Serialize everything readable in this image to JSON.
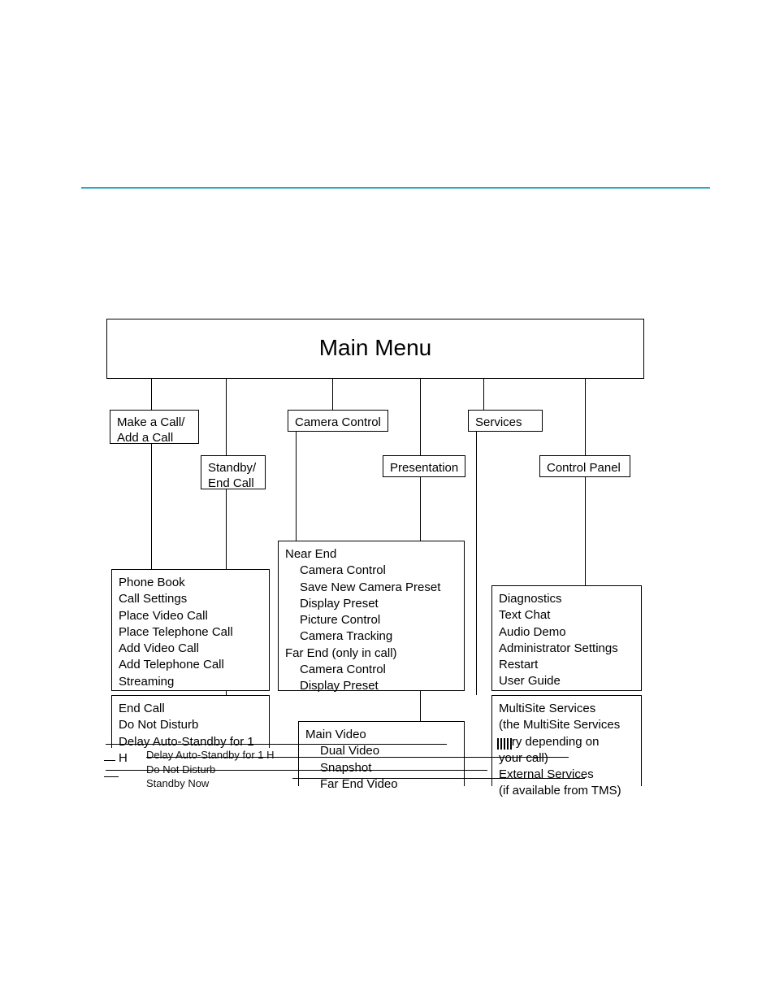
{
  "top": {
    "title": "Main Menu"
  },
  "row1": {
    "makeCall": "Make a Call/\nAdd a Call",
    "standby": "Standby/\nEnd Call",
    "camera": "Camera Control",
    "presentation": "Presentation",
    "services": "Services",
    "controlPanel": "Control Panel"
  },
  "callBox": {
    "items": [
      "Phone Book",
      "Call Settings",
      "Place Video Call",
      "Place Telephone Call",
      "Add Video Call",
      "Add Telephone Call",
      "Streaming"
    ]
  },
  "cameraBox": {
    "nearHeader": "Near End",
    "nearItems": [
      "Camera Control",
      "Save New Camera Preset",
      "Display Preset",
      "Picture Control",
      "Camera Tracking"
    ],
    "farHeader": "Far End (only in call)",
    "farItems": [
      "Camera Control",
      "Display Preset"
    ]
  },
  "controlBox": {
    "items": [
      "Diagnostics",
      "Text Chat",
      "Audio Demo",
      "Administrator Settings",
      "Restart",
      "User Guide"
    ]
  },
  "standbyBox": {
    "items": [
      "End Call",
      "Do Not Disturb",
      "Delay Auto-Standby for 1 H"
    ]
  },
  "presentationBox": {
    "header": "Main Video",
    "items": [
      "Dual Video",
      "Snapshot",
      "Far End Video"
    ]
  },
  "servicesBox": {
    "line1": "MultiSite Services",
    "line2": "(the MultiSite Services",
    "line3": "vary depending on",
    "line4": "your call)",
    "line5": "External Services",
    "line6": "(if available from TMS)"
  },
  "garbled": {
    "a": "Delay Auto-Standby for 1 H",
    "b": "Do Not Disturb",
    "c": "Standby Now"
  }
}
